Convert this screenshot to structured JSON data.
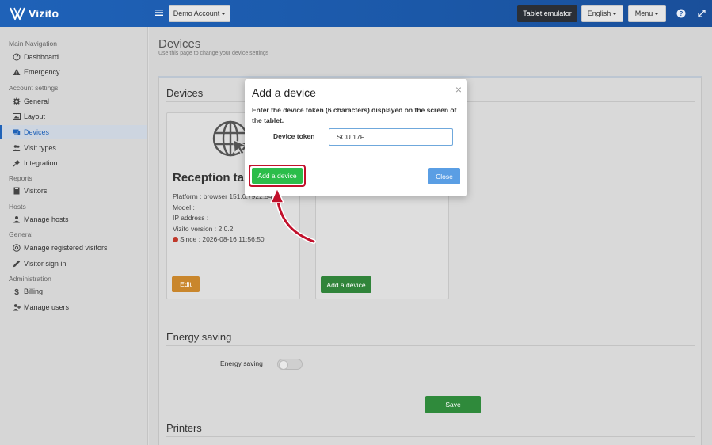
{
  "brand": {
    "name": "Vizito"
  },
  "topbar": {
    "account_label": "Demo Account",
    "tablet_emulator_label": "Tablet emulator",
    "language_label": "English",
    "menu_label": "Menu"
  },
  "sidebar": {
    "sections": [
      {
        "title": "Main Navigation",
        "items": [
          {
            "label": "Dashboard",
            "icon": "dashboard-icon"
          },
          {
            "label": "Emergency",
            "icon": "warning-icon"
          }
        ]
      },
      {
        "title": "Account settings",
        "items": [
          {
            "label": "General",
            "icon": "gear-icon"
          },
          {
            "label": "Layout",
            "icon": "image-icon"
          },
          {
            "label": "Devices",
            "icon": "devices-icon",
            "active": true
          },
          {
            "label": "Visit types",
            "icon": "users-icon"
          },
          {
            "label": "Integration",
            "icon": "plug-icon"
          }
        ]
      },
      {
        "title": "Reports",
        "items": [
          {
            "label": "Visitors",
            "icon": "book-icon"
          }
        ]
      },
      {
        "title": "Hosts",
        "items": [
          {
            "label": "Manage hosts",
            "icon": "user-icon"
          }
        ]
      },
      {
        "title": "General",
        "items": [
          {
            "label": "Manage registered visitors",
            "icon": "at-icon"
          },
          {
            "label": "Visitor sign in",
            "icon": "pencil-icon"
          }
        ]
      },
      {
        "title": "Administration",
        "items": [
          {
            "label": "Billing",
            "icon": "dollar-icon"
          },
          {
            "label": "Manage users",
            "icon": "user-plus-icon"
          }
        ]
      }
    ]
  },
  "page": {
    "title": "Devices",
    "subtitle": "Use this page to change your device settings"
  },
  "devices_section": {
    "title": "Devices",
    "device_card": {
      "name": "Reception tabl",
      "platform": "Platform : browser 151.0.7922.54",
      "model": "Model :",
      "ip": "IP address :",
      "version": "Vizito version : 2.0.2",
      "since": "Since : 2026-08-16 11:56:50",
      "edit_label": "Edit"
    },
    "add_card": {
      "add_label": "Add a device"
    }
  },
  "energy_section": {
    "title": "Energy saving",
    "label": "Energy saving",
    "save_label": "Save"
  },
  "printers_section": {
    "title": "Printers"
  },
  "modal": {
    "title": "Add a device",
    "close_symbol": "×",
    "description": "Enter the device token (6 characters) displayed on the screen of the tablet.",
    "token_label": "Device token",
    "token_value": "SCU 17F",
    "add_label": "Add a device",
    "close_label": "Close"
  },
  "colors": {
    "brand_blue": "#1f62b8",
    "add_green": "#2bbd4a",
    "close_blue": "#5a9ee4",
    "highlight_red": "#c1102b",
    "edit_orange": "#c9862c"
  }
}
